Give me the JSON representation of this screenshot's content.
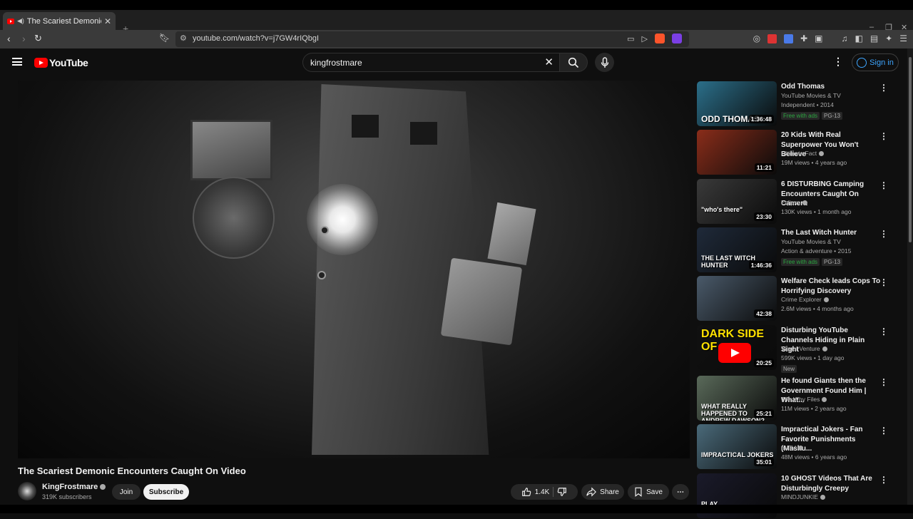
{
  "browser": {
    "tab_title": "The Scariest Demonic En",
    "url": "youtube.com/watch?v=j7GW4rIQbgI",
    "new_tab": "+",
    "badge_count": "16"
  },
  "youtube": {
    "logo_text": "YouTube",
    "search_value": "kingfrostmare",
    "sign_in": "Sign in"
  },
  "video": {
    "title": "The Scariest Demonic Encounters Caught On Video",
    "channel": "KingFrostmare",
    "subscribers": "319K subscribers",
    "join": "Join",
    "subscribe": "Subscribe",
    "likes": "1.4K",
    "share": "Share",
    "save": "Save"
  },
  "recommendations": [
    {
      "title": "Odd Thomas",
      "channel": "YouTube Movies & TV",
      "meta": "Independent • 2014",
      "badge1": "Free with ads",
      "badge2": "PG-13",
      "duration": "1:36:48",
      "thumb_text": "ODD THOMAS",
      "color": "#2b6f8a"
    },
    {
      "title": "20 Kids With Real Superpower You Won't Believe",
      "channel": "Ultimate Fact",
      "meta": "19M views • 4 years ago",
      "duration": "11:21",
      "color": "#8a2d1a"
    },
    {
      "title": "6 DISTURBING Camping Encounters Caught On Camera",
      "channel": "Eclipxe",
      "meta": "130K views • 1 month ago",
      "duration": "23:30",
      "thumb_text": "\"who's there\"",
      "color": "#3a3a3a"
    },
    {
      "title": "The Last Witch Hunter",
      "channel": "YouTube Movies & TV",
      "meta": "Action & adventure • 2015",
      "badge1": "Free with ads",
      "badge2": "PG-13",
      "duration": "1:46:36",
      "thumb_text": "THE LAST WITCH HUNTER",
      "color": "#1f2a3a"
    },
    {
      "title": "Welfare Check leads Cops To Horrifying Discovery",
      "channel": "Crime Explorer",
      "meta": "2.6M views • 4 months ago",
      "duration": "42:38",
      "color": "#4a5a6a"
    },
    {
      "title": "Disturbing YouTube Channels Hiding in Plain Sight",
      "channel": "Visual Venture",
      "meta": "599K views • 1 day ago",
      "badge1": "New",
      "duration": "20:25",
      "thumb_text": "DARK SIDE OF",
      "color": "#111111"
    },
    {
      "title": "He found Giants then the Government Found Him | What...",
      "channel": "The Why Files",
      "meta": "11M views • 2 years ago",
      "duration": "25:21",
      "thumb_text": "WHAT REALLY HAPPENED TO ANDREW DAWSON?",
      "color": "#5a6a5a"
    },
    {
      "title": "Impractical Jokers - Fan Favorite Punishments (Mashu...",
      "channel": "truTV",
      "meta": "48M views • 6 years ago",
      "duration": "35:01",
      "thumb_text": "IMPRACTICAL JOKERS",
      "color": "#4a6a7a"
    },
    {
      "title": "10 GHOST Videos That Are Disturbingly Creepy",
      "channel": "MINDJUNKIE",
      "meta": "",
      "duration": "",
      "thumb_text": "PLAY",
      "color": "#1a1a2a"
    }
  ]
}
